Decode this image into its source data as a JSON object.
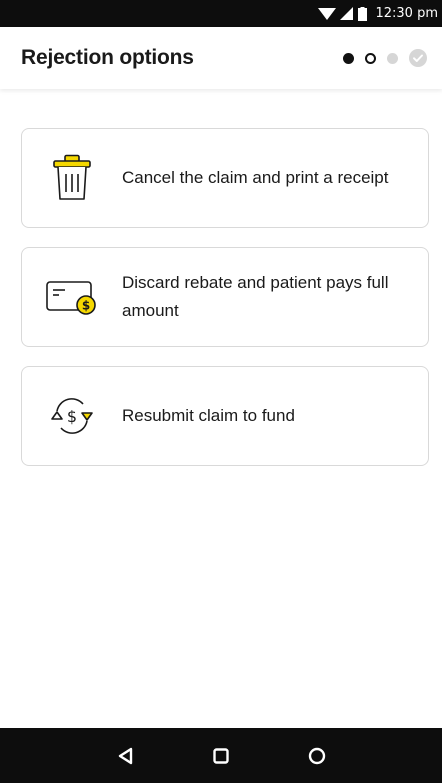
{
  "status_bar": {
    "time": "12:30 pm"
  },
  "header": {
    "title": "Rejection options",
    "steps": [
      "filled",
      "outline",
      "inactive",
      "complete"
    ]
  },
  "options": [
    {
      "label": "Cancel the claim and print a receipt",
      "icon": "trash-icon"
    },
    {
      "label": "Discard rebate and patient pays full amount",
      "icon": "card-coin-icon"
    },
    {
      "label": "Resubmit claim to fund",
      "icon": "resubmit-dollar-icon"
    }
  ],
  "colors": {
    "accent": "#f5d800",
    "text": "#1a1a1a",
    "border": "#d9d9d9",
    "bar": "#0d0d0d"
  }
}
